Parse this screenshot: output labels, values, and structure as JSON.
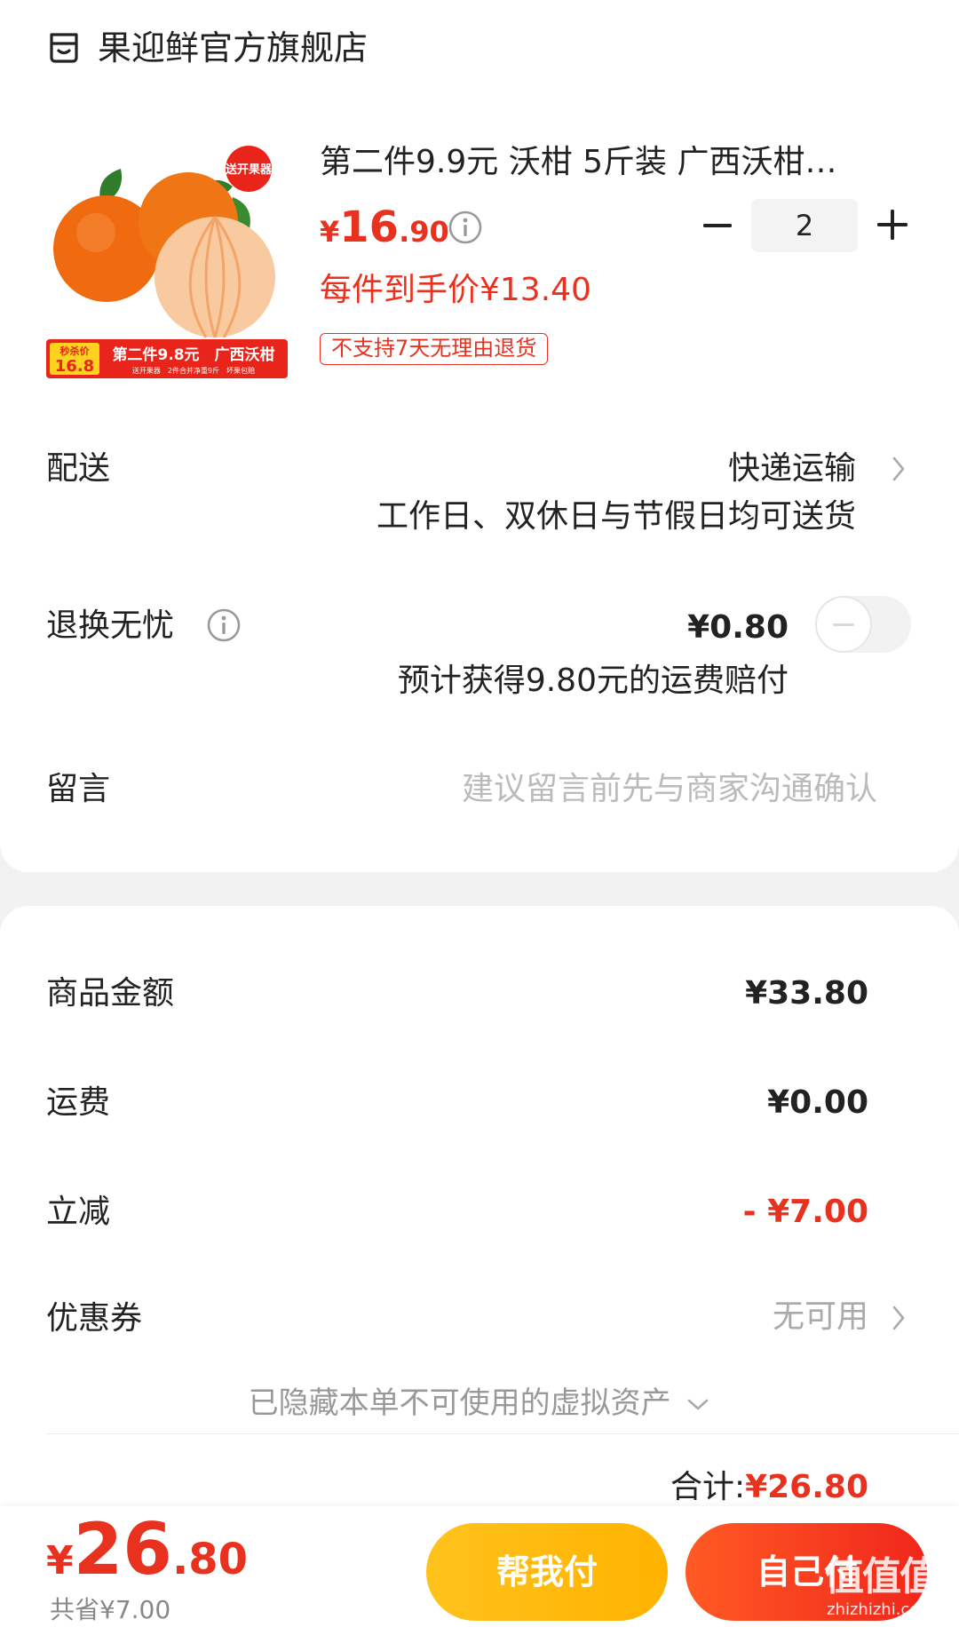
{
  "store": {
    "name": "果迎鲜官方旗舰店",
    "icon": "store-icon"
  },
  "product": {
    "title": "第二件9.9元 沃柑 5斤装 广西沃柑…",
    "price_symbol": "¥",
    "price_int": "16",
    "price_dec": ".90",
    "quantity": "2",
    "unit_price": "每件到手价¥13.40",
    "tag": "不支持7天无理由退货",
    "image_badge_top": "送开果器",
    "image_banner_left_small": "秒杀价",
    "image_banner_left_big": "16.8",
    "image_banner_text": "第二件9.8元　广西沃柑",
    "image_banner_sub": "送开果器　2件合并净重9斤　坏果包赔"
  },
  "delivery": {
    "label": "配送",
    "method": "快递运输",
    "note": "工作日、双休日与节假日均可送货"
  },
  "return_insurance": {
    "label": "退换无忧",
    "price": "¥0.80",
    "note": "预计获得9.80元的运费赔付",
    "enabled": false
  },
  "message": {
    "label": "留言",
    "placeholder": "建议留言前先与商家沟通确认"
  },
  "summary": {
    "goods_label": "商品金额",
    "goods_value": "¥33.80",
    "shipping_label": "运费",
    "shipping_value": "¥0.00",
    "discount_label": "立减",
    "discount_value": "- ¥7.00",
    "coupon_label": "优惠券",
    "coupon_value": "无可用",
    "hidden_assets": "已隐藏本单不可使用的虚拟资产",
    "total_label": "合计:",
    "total_value": "¥26.80"
  },
  "footer": {
    "price_symbol": "¥",
    "price_int": "26",
    "price_dec": ".80",
    "saved": "共省¥7.00",
    "help_pay": "帮我付",
    "self_pay": "自己付"
  },
  "watermark": {
    "big": "值值值",
    "small": "zhizhizhi.com"
  },
  "colors": {
    "accent": "#e8321f",
    "yellow": "#ffc21c",
    "muted": "#888888"
  }
}
